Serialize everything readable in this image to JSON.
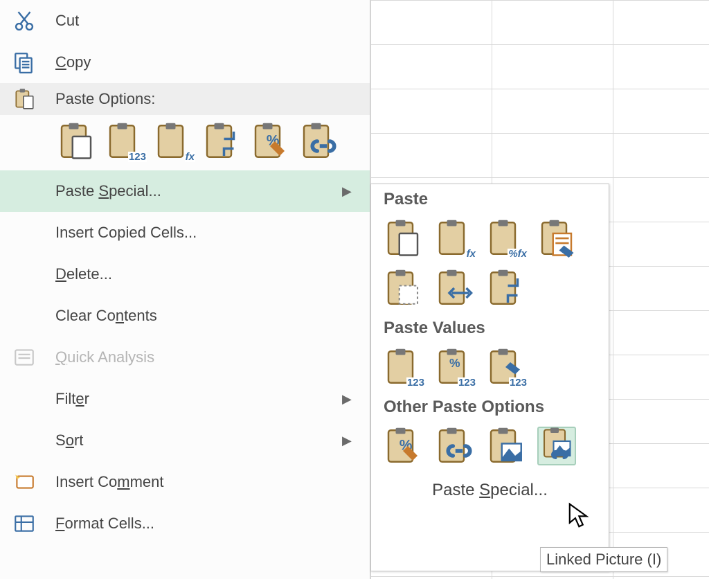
{
  "context_menu": {
    "cut": "Cut",
    "copy": "Copy",
    "paste_options_heading": "Paste Options:",
    "paste_special": "Paste Special...",
    "insert_copied_cells": "Insert Copied Cells...",
    "delete": "Delete...",
    "clear_contents": "Clear Contents",
    "quick_analysis": "Quick Analysis",
    "filter": "Filter",
    "sort": "Sort",
    "insert_comment": "Insert Comment",
    "format_cells": "Format Cells..."
  },
  "paste_option_icons": [
    "paste",
    "paste-values-123",
    "paste-formulas-fx",
    "paste-transpose",
    "paste-formatting-percent",
    "paste-link"
  ],
  "submenu": {
    "paste_heading": "Paste",
    "paste_row1": [
      "paste",
      "paste-formulas-fx",
      "paste-formulas-number-fmt",
      "paste-source-formatting"
    ],
    "paste_row2": [
      "paste-no-borders",
      "paste-column-widths",
      "paste-transpose"
    ],
    "paste_values_heading": "Paste Values",
    "values_row": [
      "paste-values-123",
      "paste-values-number-fmt-123",
      "paste-values-source-fmt-123"
    ],
    "other_heading": "Other Paste Options",
    "other_row": [
      "paste-formatting",
      "paste-link",
      "paste-picture",
      "paste-linked-picture"
    ],
    "paste_special": "Paste Special..."
  },
  "tooltip": "Linked Picture (I)",
  "colors": {
    "clipboard_fill": "#e3cfa3",
    "clipboard_dark": "#8a6a2e",
    "accent_blue": "#3a6ea5",
    "accent_orange": "#c77a2d",
    "highlight": "#d6ede0"
  }
}
